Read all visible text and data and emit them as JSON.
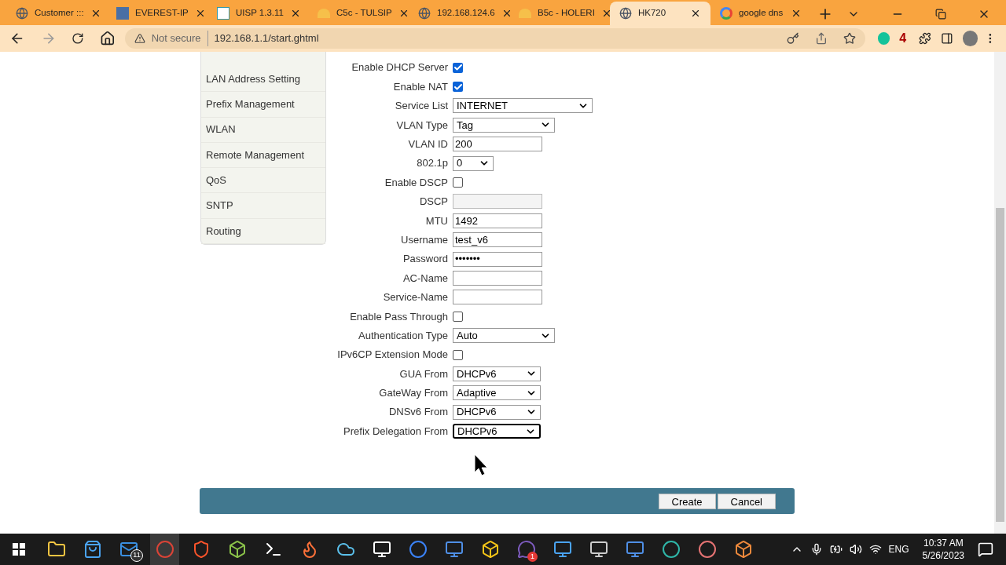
{
  "tabs": [
    {
      "title": "Customer :::",
      "selected": false
    },
    {
      "title": "EVEREST-IP",
      "selected": false
    },
    {
      "title": "UISP 1.3.11",
      "selected": false
    },
    {
      "title": "C5c - TULSIP",
      "selected": false
    },
    {
      "title": "192.168.124.6",
      "selected": false
    },
    {
      "title": "B5c - HOLERI",
      "selected": false
    },
    {
      "title": "HK720",
      "selected": true
    },
    {
      "title": "google dns",
      "selected": false
    }
  ],
  "address_bar": {
    "security": "Not secure",
    "url": "192.168.1.1/start.ghtml"
  },
  "extension_badge": "4",
  "sidebar": {
    "items": [
      {
        "label": "LAN Address Setting",
        "selected": false
      },
      {
        "label": "Prefix Management",
        "selected": false
      },
      {
        "label": "WLAN",
        "selected": false
      },
      {
        "label": "Remote Management",
        "selected": false
      },
      {
        "label": "QoS",
        "selected": false
      },
      {
        "label": "SNTP",
        "selected": false
      },
      {
        "label": "Routing",
        "selected": false
      }
    ]
  },
  "form": [
    {
      "label": "Enable DHCP Server",
      "kind": "checkbox",
      "checked": true
    },
    {
      "label": "Enable NAT",
      "kind": "checkbox",
      "checked": true
    },
    {
      "label": "Service List",
      "kind": "select",
      "value": "INTERNET"
    },
    {
      "label": "VLAN Type",
      "kind": "select",
      "value": "Tag"
    },
    {
      "label": "VLAN ID",
      "kind": "text",
      "value": "200"
    },
    {
      "label": "802.1p",
      "kind": "select",
      "value": "0"
    },
    {
      "label": "Enable DSCP",
      "kind": "checkbox",
      "checked": false
    },
    {
      "label": "DSCP",
      "kind": "text",
      "disabled": true
    },
    {
      "label": "MTU",
      "kind": "text",
      "value": "1492"
    },
    {
      "label": "Username",
      "kind": "text",
      "value": "test_v6"
    },
    {
      "label": "Password",
      "kind": "password",
      "value": "•••••••"
    },
    {
      "label": "AC-Name",
      "kind": "text"
    },
    {
      "label": "Service-Name",
      "kind": "text"
    },
    {
      "label": "Enable Pass Through",
      "kind": "checkbox",
      "checked": false
    },
    {
      "label": "Authentication Type",
      "kind": "select",
      "value": "Auto"
    },
    {
      "label": "IPv6CP Extension Mode",
      "kind": "checkbox",
      "checked": false
    },
    {
      "label": "GUA From",
      "kind": "select",
      "value": "DHCPv6"
    },
    {
      "label": "GateWay From",
      "kind": "select",
      "value": "Adaptive"
    },
    {
      "label": "DNSv6 From",
      "kind": "select",
      "value": "DHCPv6"
    },
    {
      "label": "Prefix Delegation From",
      "kind": "select",
      "value": "DHCPv6",
      "focused": true
    }
  ],
  "buttons": [
    "Create",
    "Cancel"
  ],
  "taskbar": {
    "mail_badge": "11",
    "chat_badge": "1",
    "language": "ENG",
    "time": "10:37 AM",
    "date": "5/26/2023"
  }
}
